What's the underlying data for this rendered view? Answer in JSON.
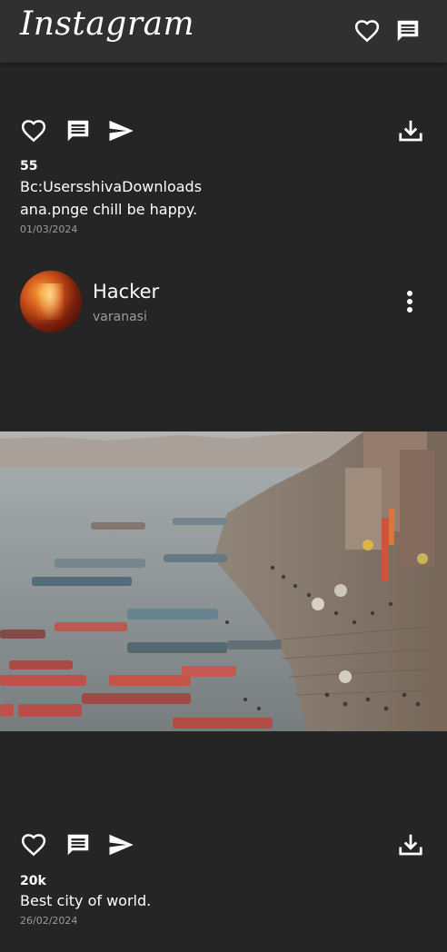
{
  "appbar": {
    "title": "Instagram",
    "icons": [
      "heart-outline-icon",
      "chat-icon"
    ]
  },
  "post1": {
    "likes": "55",
    "caption_line1": "Bc:UsersshivaDownloads",
    "caption_line2": "ana.pnge chill be happy.",
    "date": "01/03/2024"
  },
  "post2": {
    "username": "Hacker",
    "location": "varanasi",
    "likes": "20k",
    "caption": "Best city of world.",
    "date": "26/02/2024"
  },
  "colors": {
    "background": "#252525",
    "appbar": "#303030",
    "text": "#ffffff",
    "muted": "#9a9a9a"
  }
}
